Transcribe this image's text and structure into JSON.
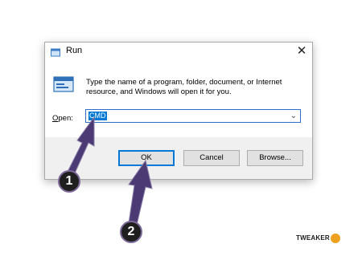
{
  "dialog": {
    "title": "Run",
    "message": "Type the name of a program, folder, document, or Internet resource, and Windows will open it for you.",
    "open_label": "Open:",
    "open_value": "CMD",
    "buttons": {
      "ok": "OK",
      "cancel": "Cancel",
      "browse": "Browse..."
    }
  },
  "annotations": {
    "step1": "1",
    "step2": "2"
  },
  "watermark": {
    "text": "TWEAKER"
  },
  "colors": {
    "accent": "#0078d7",
    "arrow": "#4b3a73",
    "watermark_accent": "#f0a020"
  },
  "icons": [
    "run-title-icon",
    "close-icon",
    "run-app-icon",
    "chevron-down-icon"
  ]
}
